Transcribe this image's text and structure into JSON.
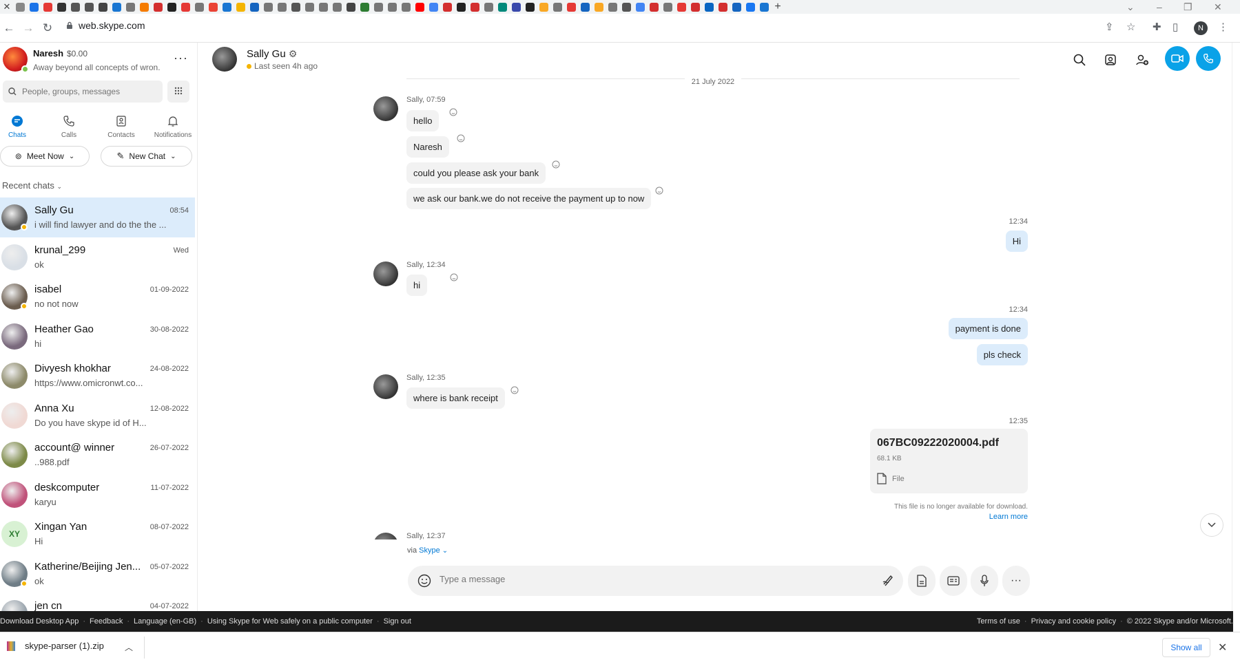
{
  "browser": {
    "url": "web.skype.com",
    "new_tab_glyph": "+",
    "window_controls": [
      "⌄",
      "–",
      "❐",
      "✕"
    ]
  },
  "profile": {
    "name": "Naresh",
    "credit": "$0.00",
    "mood": "Away beyond all concepts of wron...",
    "more": "···",
    "status_color": "#7bc24d"
  },
  "search": {
    "placeholder": "People, groups, messages"
  },
  "nav_tabs": [
    {
      "label": "Chats",
      "icon": "chat-icon",
      "active": true
    },
    {
      "label": "Calls",
      "icon": "phone-icon",
      "active": false
    },
    {
      "label": "Contacts",
      "icon": "contacts-icon",
      "active": false
    },
    {
      "label": "Notifications",
      "icon": "bell-icon",
      "active": false
    }
  ],
  "actions": {
    "meet_now": "Meet Now",
    "new_chat": "New Chat"
  },
  "recent_label": "Recent chats",
  "chats": [
    {
      "name": "Sally Gu",
      "date": "08:54",
      "preview": "i will find lawyer and do the the ...",
      "active": true,
      "presence": "#f5b400",
      "avatar": "#555555"
    },
    {
      "name": "krunal_299",
      "date": "Wed",
      "preview": "ok",
      "presence": "",
      "avatar": "#d9dfe6"
    },
    {
      "name": "isabel",
      "date": "01-09-2022",
      "preview": "no not now",
      "presence": "#f5b400",
      "avatar": "#6b5d4f"
    },
    {
      "name": "Heather Gao",
      "date": "30-08-2022",
      "preview": "hi",
      "presence": "",
      "avatar": "#7a6a7d"
    },
    {
      "name": "Divyesh khokhar",
      "date": "24-08-2022",
      "preview": "https://www.omicronwt.co...",
      "presence": "",
      "avatar": "#8d8a6a"
    },
    {
      "name": "Anna Xu",
      "date": "12-08-2022",
      "preview": "Do you have skype id of H...",
      "presence": "",
      "avatar": "#f0d9d4"
    },
    {
      "name": "account@ winner",
      "date": "26-07-2022",
      "preview": "..988.pdf",
      "presence": "",
      "avatar": "#7d8a48"
    },
    {
      "name": "deskcomputer",
      "date": "11-07-2022",
      "preview": "karyu",
      "presence": "",
      "avatar": "#c0527a"
    },
    {
      "name": "Xingan  Yan",
      "date": "08-07-2022",
      "preview": "Hi",
      "presence": "",
      "avatar": "#d8f1d3",
      "initials": "XY"
    },
    {
      "name": "Katherine/Beijing Jen...",
      "date": "05-07-2022",
      "preview": "ok",
      "presence": "#f5b400",
      "avatar": "#6f7d86"
    },
    {
      "name": "jen cn",
      "date": "04-07-2022",
      "preview": "",
      "presence": "",
      "avatar": "#9aa4ad"
    }
  ],
  "conversation": {
    "name": "Sally Gu",
    "status": "Last seen 4h ago",
    "status_color": "#f5b400",
    "date_separator": "21 July 2022",
    "m1_meta": "Sally, 07:59",
    "m1": [
      "hello",
      "Naresh",
      "could you please ask your bank",
      "we ask our bank.we do not receive the payment up to now"
    ],
    "o1_time": "12:34",
    "o1": "Hi",
    "m2_meta": "Sally, 12:34",
    "m2": "hi",
    "o2_time": "12:34",
    "o2": [
      "payment is done",
      "pls check"
    ],
    "m3_meta": "Sally, 12:35",
    "m3": "where is bank receipt",
    "file_time": "12:35",
    "file": {
      "name": "067BC09222020004.pdf",
      "size": "68.1 KB",
      "type": "File",
      "note": "This file is no longer available for download.",
      "learn_more": "Learn more"
    },
    "m4_meta": "Sally, 12:37"
  },
  "composer": {
    "via": "via",
    "via_link": "Skype",
    "placeholder": "Type a message"
  },
  "footer": {
    "left": [
      "Download Desktop App",
      "Feedback",
      "Language (en-GB)",
      "Using Skype for Web safely on a public computer",
      "Sign out"
    ],
    "right": [
      "Terms of use",
      "Privacy and cookie policy",
      "© 2022 Skype and/or Microsoft."
    ]
  },
  "download": {
    "filename": "skype-parser (1).zip",
    "show_all": "Show all"
  },
  "colors": {
    "accent": "#0078d4",
    "call_button": "#0aa2e8",
    "own_bubble": "#dcecfb"
  }
}
